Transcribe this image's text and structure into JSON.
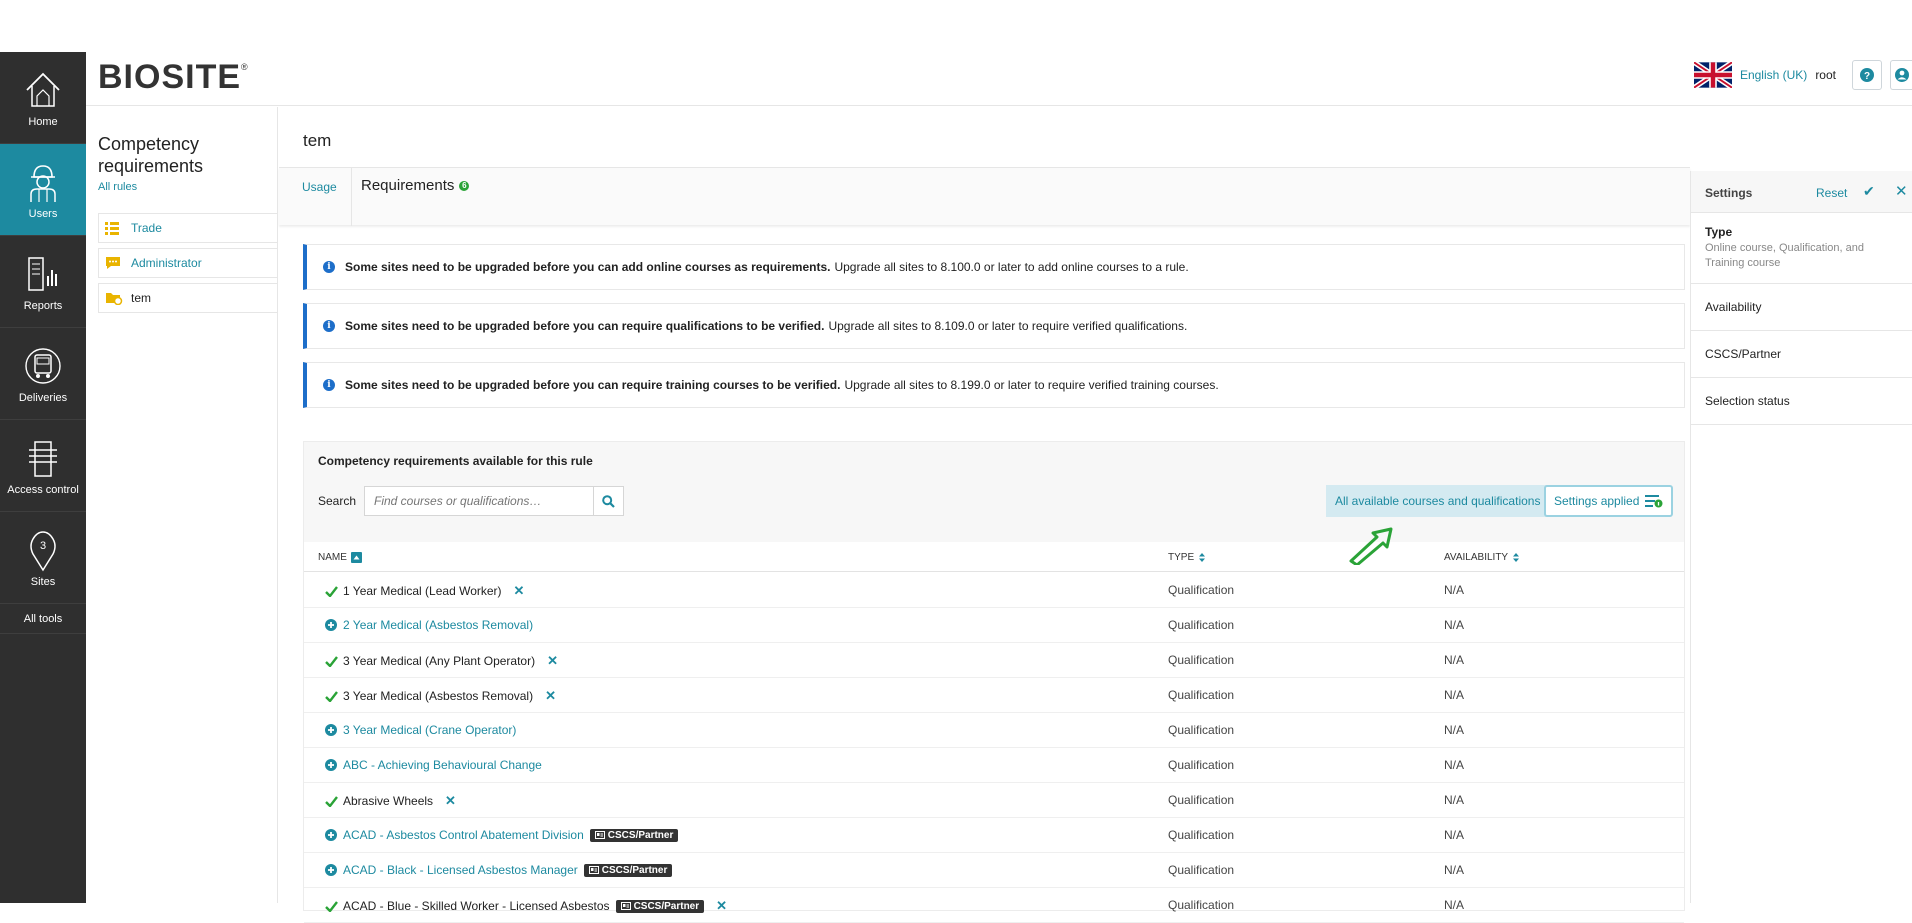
{
  "nav": {
    "items": [
      {
        "label": "Home",
        "icon": "house-icon",
        "active": false
      },
      {
        "label": "Users",
        "icon": "user-hardhat-icon",
        "active": true
      },
      {
        "label": "Reports",
        "icon": "report-icon",
        "active": false
      },
      {
        "label": "Deliveries",
        "icon": "truck-icon",
        "active": false
      },
      {
        "label": "Access control",
        "icon": "turnstile-icon",
        "active": false
      },
      {
        "label": "Sites",
        "icon": "map-pin-icon",
        "active": false,
        "pin_number": "3"
      }
    ],
    "all_tools": "All tools"
  },
  "header": {
    "logo": "BIOSITE",
    "logo_mark": "®",
    "language": "English (UK)",
    "user": "root",
    "help_icon": "question-icon",
    "profile_icon": "user-circle-icon"
  },
  "sidebar": {
    "title": "Competency requirements",
    "all_rules": "All rules",
    "rules": [
      {
        "label": "Trade",
        "icon": "list-icon",
        "link": true
      },
      {
        "label": "Administrator",
        "icon": "chat-bubble-icon",
        "link": true
      },
      {
        "label": "tem",
        "icon": "folder-settings-icon",
        "link": false
      }
    ]
  },
  "main": {
    "title": "tem",
    "tab_usage": "Usage",
    "tab_requirements": "Requirements",
    "requirements_count": "6",
    "notices": [
      {
        "bold": "Some sites need to be upgraded before you can add online courses as requirements.",
        "text": "Upgrade all sites to 8.100.0 or later to add online courses to a rule."
      },
      {
        "bold": "Some sites need to be upgraded before you can require qualifications to be verified.",
        "text": "Upgrade all sites to 8.109.0 or later to require verified qualifications."
      },
      {
        "bold": "Some sites need to be upgraded before you can require training courses to be verified.",
        "text": "Upgrade all sites to 8.199.0 or later to require verified training courses."
      }
    ],
    "panel": {
      "title": "Competency requirements available for this rule",
      "search_label": "Search",
      "search_placeholder": "Find courses or qualifications…",
      "filter_label": "All available courses and qualifications",
      "settings_label": "Settings applied",
      "columns": {
        "name": "NAME",
        "type": "TYPE",
        "availability": "AVAILABILITY"
      },
      "rows": [
        {
          "name": "1 Year Medical (Lead Worker)",
          "status": "selected",
          "type": "Qualification",
          "availability": "N/A",
          "badge": ""
        },
        {
          "name": "2 Year Medical (Asbestos Removal)",
          "status": "available",
          "type": "Qualification",
          "availability": "N/A",
          "badge": ""
        },
        {
          "name": "3 Year Medical (Any Plant Operator)",
          "status": "selected",
          "type": "Qualification",
          "availability": "N/A",
          "badge": ""
        },
        {
          "name": "3 Year Medical (Asbestos Removal)",
          "status": "selected",
          "type": "Qualification",
          "availability": "N/A",
          "badge": ""
        },
        {
          "name": "3 Year Medical (Crane Operator)",
          "status": "available",
          "type": "Qualification",
          "availability": "N/A",
          "badge": ""
        },
        {
          "name": "ABC - Achieving Behavioural Change",
          "status": "available",
          "type": "Qualification",
          "availability": "N/A",
          "badge": ""
        },
        {
          "name": "Abrasive Wheels",
          "status": "selected",
          "type": "Qualification",
          "availability": "N/A",
          "badge": ""
        },
        {
          "name": "ACAD - Asbestos Control Abatement Division",
          "status": "available",
          "type": "Qualification",
          "availability": "N/A",
          "badge": "CSCS/Partner"
        },
        {
          "name": "ACAD - Black - Licensed Asbestos Manager",
          "status": "available",
          "type": "Qualification",
          "availability": "N/A",
          "badge": "CSCS/Partner"
        },
        {
          "name": "ACAD - Blue - Skilled Worker - Licensed Asbestos",
          "status": "selected",
          "type": "Qualification",
          "availability": "N/A",
          "badge": "CSCS/Partner"
        }
      ]
    }
  },
  "settings_panel": {
    "title": "Settings",
    "reset": "Reset",
    "items": [
      {
        "label": "Type",
        "sub": "Online course, Qualification, and Training course"
      },
      {
        "label": "Availability",
        "sub": ""
      },
      {
        "label": "CSCS/Partner",
        "sub": ""
      },
      {
        "label": "Selection status",
        "sub": ""
      }
    ]
  },
  "colors": {
    "accent": "#1d8aa0",
    "nav_bg": "#2f2f2f",
    "success": "#2aa337",
    "info": "#1d6ec9"
  }
}
